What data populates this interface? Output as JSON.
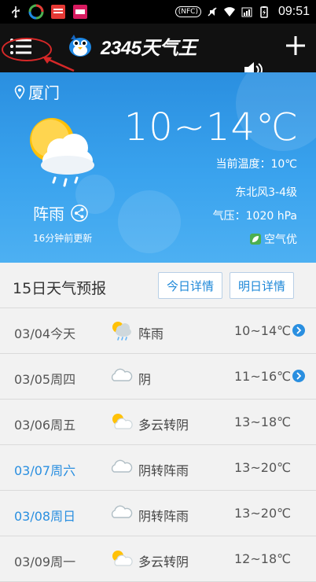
{
  "status": {
    "nfc": "(NFC)",
    "time": "09:51"
  },
  "app": {
    "logo_text": "2345天气王"
  },
  "current": {
    "city": "厦门",
    "temp_range": "10~14℃",
    "current_temp": "当前温度：10℃",
    "wind": "东北风3-4级",
    "pressure": "气压：1020 hPa",
    "description": "阵雨",
    "updated": "16分钟前更新",
    "air_quality": "空气优"
  },
  "forecast": {
    "title": "15日天气预报",
    "today_details": "今日详情",
    "tomorrow_details": "明日详情",
    "days": [
      {
        "date": "03/04今天",
        "icon": "sun-cloud-rain-icon",
        "condition": "阵雨",
        "temp": "10~14℃",
        "weekend": false,
        "chevron": true
      },
      {
        "date": "03/05周四",
        "icon": "cloud-icon",
        "condition": "阴",
        "temp": "11~16℃",
        "weekend": false,
        "chevron": true
      },
      {
        "date": "03/06周五",
        "icon": "partly-cloudy-icon",
        "condition": "多云转阴",
        "temp": "13~18℃",
        "weekend": false,
        "chevron": false
      },
      {
        "date": "03/07周六",
        "icon": "cloud-icon",
        "condition": "阴转阵雨",
        "temp": "13~20℃",
        "weekend": true,
        "chevron": false
      },
      {
        "date": "03/08周日",
        "icon": "cloud-icon",
        "condition": "阴转阵雨",
        "temp": "13~20℃",
        "weekend": true,
        "chevron": false
      },
      {
        "date": "03/09周一",
        "icon": "partly-cloudy-icon",
        "condition": "多云转阴",
        "temp": "12~18℃",
        "weekend": false,
        "chevron": false
      }
    ]
  },
  "colors": {
    "accent": "#2a8fe0",
    "hero_top": "#2a8fe0",
    "hero_bottom": "#4db0f2",
    "annotation": "#d62828"
  }
}
